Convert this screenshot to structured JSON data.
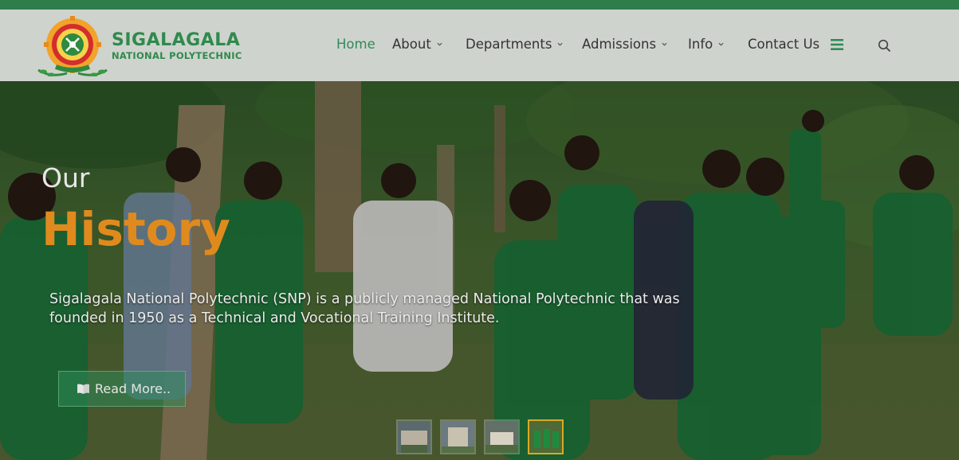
{
  "brand": {
    "line1": "SIGALAGALA",
    "line2": "NATIONAL POLYTECHNIC",
    "colors": {
      "green": "#2f8a4c",
      "accent": "#e08a1e",
      "topbar": "#2e7d4a"
    }
  },
  "nav": {
    "items": [
      {
        "label": "Home",
        "active": true,
        "dropdown": false
      },
      {
        "label": "About",
        "active": false,
        "dropdown": true
      },
      {
        "label": "Departments",
        "active": false,
        "dropdown": true
      },
      {
        "label": "Admissions",
        "active": false,
        "dropdown": true
      },
      {
        "label": "Info",
        "active": false,
        "dropdown": true
      },
      {
        "label": "Contact Us",
        "active": false,
        "dropdown": false
      }
    ],
    "menu_icon": "hamburger-icon",
    "search_icon": "search-icon"
  },
  "hero": {
    "kicker": "Our",
    "title": "History",
    "description": "Sigalagala National Polytechnic (SNP) is a publicly managed National Polytechnic that was founded in 1950 as a Technical and Vocational Training Institute.",
    "button_label": "Read More..",
    "button_icon": "book-icon"
  },
  "slider": {
    "slide_count": 4,
    "active_index": 3
  }
}
